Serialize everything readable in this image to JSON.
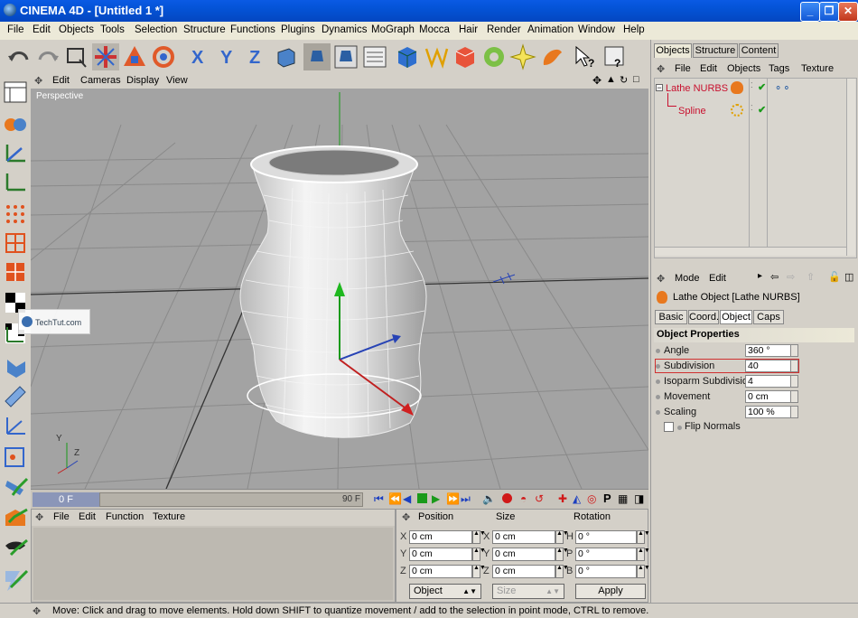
{
  "window": {
    "title": "CINEMA 4D - [Untitled 1 *]"
  },
  "menu": [
    "File",
    "Edit",
    "Objects",
    "Tools",
    "Selection",
    "Structure",
    "Functions",
    "Plugins",
    "Dynamics",
    "MoGraph",
    "Mocca",
    "Hair",
    "Render",
    "Animation",
    "Window",
    "Help"
  ],
  "viewport": {
    "menu": [
      "Edit",
      "Cameras",
      "Display",
      "View"
    ],
    "label": "Perspective",
    "axis_labels": [
      "Y",
      "Z"
    ]
  },
  "watermark": "TechTut.com",
  "timeline": {
    "current_frame": "0 F",
    "end_frame": "90 F"
  },
  "material_manager": {
    "menu": [
      "File",
      "Edit",
      "Function",
      "Texture"
    ]
  },
  "coordinates": {
    "headers": [
      "Position",
      "Size",
      "Rotation"
    ],
    "rows": [
      {
        "pos_axis": "X",
        "pos": "0 cm",
        "size_axis": "X",
        "size": "0 cm",
        "rot_axis": "H",
        "rot": "0 °"
      },
      {
        "pos_axis": "Y",
        "pos": "0 cm",
        "size_axis": "Y",
        "size": "0 cm",
        "rot_axis": "P",
        "rot": "0 °"
      },
      {
        "pos_axis": "Z",
        "pos": "0 cm",
        "size_axis": "Z",
        "size": "0 cm",
        "rot_axis": "B",
        "rot": "0 °"
      }
    ],
    "mode_select": "Object",
    "size_select": "Size",
    "apply_label": "Apply"
  },
  "object_manager": {
    "tabs": [
      "Objects",
      "Structure",
      "Content"
    ],
    "menu": [
      "File",
      "Edit",
      "Objects",
      "Tags",
      "Texture"
    ],
    "objects": [
      {
        "name": "Lathe NURBS"
      },
      {
        "name": "Spline"
      }
    ]
  },
  "attributes": {
    "menu": [
      "Mode",
      "Edit"
    ],
    "object_title": "Lathe Object [Lathe NURBS]",
    "tabs": [
      "Basic",
      "Coord.",
      "Object",
      "Caps"
    ],
    "section": "Object Properties",
    "fields": [
      {
        "label": "Angle",
        "value": "360 °"
      },
      {
        "label": "Subdivision",
        "value": "40"
      },
      {
        "label": "Isoparm Subdivision",
        "value": "4"
      },
      {
        "label": "Movement",
        "value": "0 cm"
      },
      {
        "label": "Scaling",
        "value": "100 %"
      }
    ],
    "checkbox_label": "Flip Normals"
  },
  "status": "Move: Click and drag to move elements. Hold down SHIFT to quantize movement / add to the selection in point mode, CTRL to remove.",
  "colors": {
    "title_bar": "#0453d6",
    "viewport_bg": "#a5a5a5",
    "object_name": "#c8102e",
    "highlight": "#d03030"
  }
}
